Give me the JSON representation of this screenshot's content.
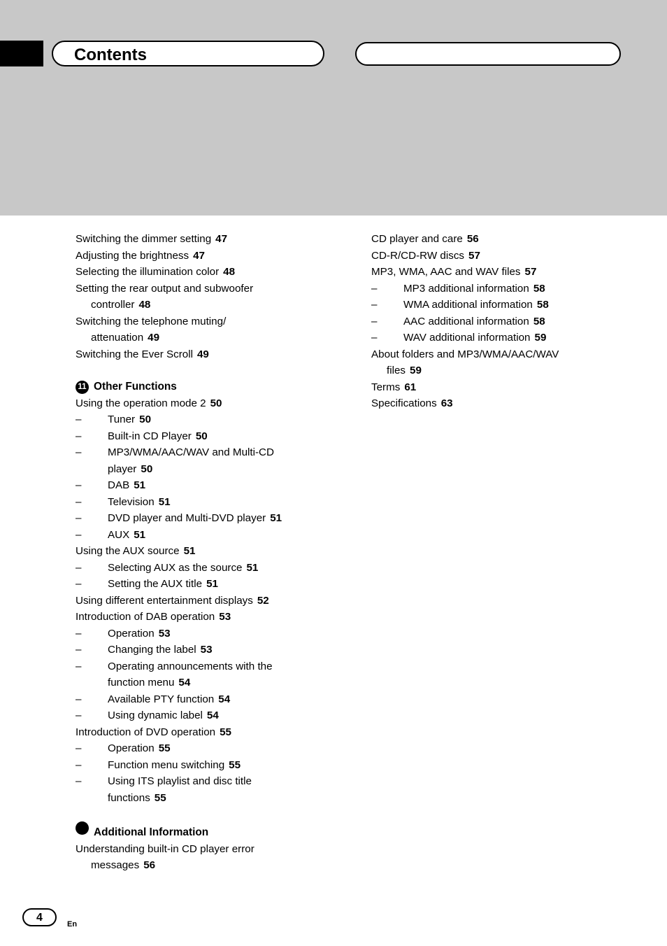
{
  "header": {
    "title": "Contents"
  },
  "footer": {
    "page_number": "4",
    "language": "En"
  },
  "left_column": [
    {
      "type": "entry",
      "level": 1,
      "label": "Switching the dimmer setting",
      "page": "47"
    },
    {
      "type": "entry",
      "level": 1,
      "label": "Adjusting the brightness",
      "page": "47"
    },
    {
      "type": "entry",
      "level": 1,
      "label": "Selecting the illumination color",
      "page": "48"
    },
    {
      "type": "entry",
      "level": 1,
      "label": "Setting the rear output and subwoofer",
      "page": ""
    },
    {
      "type": "cont",
      "level": 1,
      "label": "controller",
      "page": "48"
    },
    {
      "type": "entry",
      "level": 1,
      "label": "Switching the telephone muting/",
      "page": ""
    },
    {
      "type": "cont",
      "level": 1,
      "label": "attenuation",
      "page": "49"
    },
    {
      "type": "entry",
      "level": 1,
      "label": "Switching the Ever Scroll",
      "page": "49"
    },
    {
      "type": "section",
      "badge": "11",
      "label": "Other Functions"
    },
    {
      "type": "entry",
      "level": 1,
      "label": "Using the operation mode 2",
      "page": "50"
    },
    {
      "type": "entry",
      "level": 2,
      "label": "Tuner",
      "page": "50"
    },
    {
      "type": "entry",
      "level": 2,
      "label": "Built-in CD Player",
      "page": "50"
    },
    {
      "type": "entry",
      "level": 2,
      "label": "MP3/WMA/AAC/WAV and Multi-CD",
      "page": ""
    },
    {
      "type": "cont2",
      "level": 2,
      "label": "player",
      "page": "50"
    },
    {
      "type": "entry",
      "level": 2,
      "label": "DAB",
      "page": "51"
    },
    {
      "type": "entry",
      "level": 2,
      "label": "Television",
      "page": "51"
    },
    {
      "type": "entry",
      "level": 2,
      "label": "DVD player and Multi-DVD player",
      "page": "51"
    },
    {
      "type": "entry",
      "level": 2,
      "label": "AUX",
      "page": "51"
    },
    {
      "type": "entry",
      "level": 1,
      "label": "Using the AUX source",
      "page": "51"
    },
    {
      "type": "entry",
      "level": 2,
      "label": "Selecting AUX as the source",
      "page": "51"
    },
    {
      "type": "entry",
      "level": 2,
      "label": "Setting the AUX title",
      "page": "51"
    },
    {
      "type": "entry",
      "level": 1,
      "label": "Using different entertainment displays",
      "page": "52"
    },
    {
      "type": "entry",
      "level": 1,
      "label": "Introduction of DAB operation",
      "page": "53"
    },
    {
      "type": "entry",
      "level": 2,
      "label": "Operation",
      "page": "53"
    },
    {
      "type": "entry",
      "level": 2,
      "label": "Changing the label",
      "page": "53"
    },
    {
      "type": "entry",
      "level": 2,
      "label": "Operating announcements with the",
      "page": ""
    },
    {
      "type": "cont2",
      "level": 2,
      "label": "function menu",
      "page": "54"
    },
    {
      "type": "entry",
      "level": 2,
      "label": "Available PTY function",
      "page": "54"
    },
    {
      "type": "entry",
      "level": 2,
      "label": "Using dynamic label",
      "page": "54"
    },
    {
      "type": "entry",
      "level": 1,
      "label": "Introduction of DVD operation",
      "page": "55"
    },
    {
      "type": "entry",
      "level": 2,
      "label": "Operation",
      "page": "55"
    },
    {
      "type": "entry",
      "level": 2,
      "label": "Function menu switching",
      "page": "55"
    },
    {
      "type": "entry",
      "level": 2,
      "label": "Using ITS playlist and disc title",
      "page": ""
    },
    {
      "type": "cont2",
      "level": 2,
      "label": "functions",
      "page": "55"
    },
    {
      "type": "section",
      "badge": "",
      "label": "Additional Information"
    },
    {
      "type": "entry",
      "level": 1,
      "label": "Understanding built-in CD player error",
      "page": ""
    },
    {
      "type": "cont",
      "level": 1,
      "label": "messages",
      "page": "56"
    }
  ],
  "right_column": [
    {
      "type": "entry",
      "level": 1,
      "label": "CD player and care",
      "page": "56"
    },
    {
      "type": "entry",
      "level": 1,
      "label": "CD-R/CD-RW discs",
      "page": "57"
    },
    {
      "type": "entry",
      "level": 1,
      "label": "MP3, WMA, AAC and WAV files",
      "page": "57"
    },
    {
      "type": "entry",
      "level": 2,
      "label": "MP3 additional information",
      "page": "58"
    },
    {
      "type": "entry",
      "level": 2,
      "label": "WMA additional information",
      "page": "58"
    },
    {
      "type": "entry",
      "level": 2,
      "label": "AAC additional information",
      "page": "58"
    },
    {
      "type": "entry",
      "level": 2,
      "label": "WAV additional information",
      "page": "59"
    },
    {
      "type": "entry",
      "level": 1,
      "label": "About folders and MP3/WMA/AAC/WAV",
      "page": ""
    },
    {
      "type": "cont",
      "level": 1,
      "label": "files",
      "page": "59"
    },
    {
      "type": "entry",
      "level": 1,
      "label": "Terms",
      "page": "61"
    },
    {
      "type": "entry",
      "level": 1,
      "label": "Specifications",
      "page": "63"
    }
  ]
}
